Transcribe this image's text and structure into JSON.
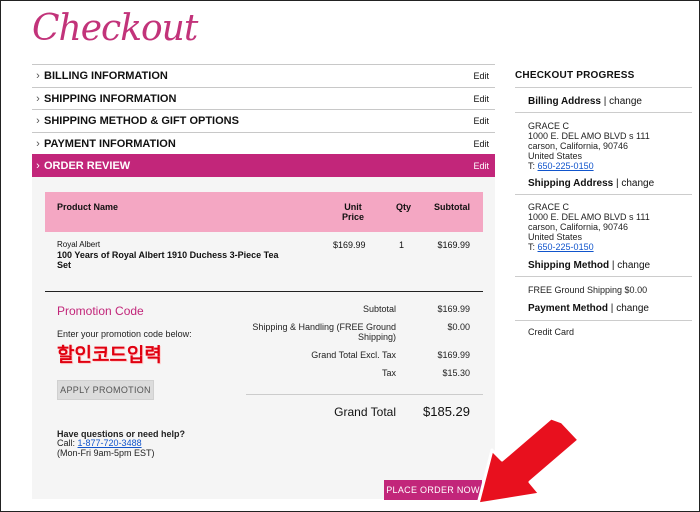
{
  "logo": "Checkout",
  "accordion": [
    {
      "label": "BILLING INFORMATION",
      "edit": "Edit"
    },
    {
      "label": "SHIPPING INFORMATION",
      "edit": "Edit"
    },
    {
      "label": "SHIPPING METHOD & GIFT OPTIONS",
      "edit": "Edit"
    },
    {
      "label": "PAYMENT INFORMATION",
      "edit": "Edit"
    },
    {
      "label": "ORDER REVIEW",
      "edit": "Edit"
    }
  ],
  "table": {
    "col_product": "Product Name",
    "col_unit_price_1": "Unit",
    "col_unit_price_2": "Price",
    "col_qty": "Qty",
    "col_subtotal": "Subtotal"
  },
  "item": {
    "brand": "Royal Albert",
    "name_line1": "100 Years of Royal Albert 1910 Duchess 3-Piece Tea",
    "name_line2": "Set",
    "unit_price": "$169.99",
    "qty": "1",
    "subtotal": "$169.99"
  },
  "promo": {
    "title": "Promotion Code",
    "subtitle": "Enter your promotion code below:",
    "input_value": "할인코드입력",
    "apply_label": "APPLY PROMOTION"
  },
  "totals": {
    "subtotal_label": "Subtotal",
    "subtotal": "$169.99",
    "shipping_label_1": "Shipping & Handling (FREE Ground",
    "shipping_label_2": "Shipping)",
    "shipping": "$0.00",
    "gt_excl_label": "Grand Total Excl. Tax",
    "gt_excl": "$169.99",
    "tax_label": "Tax",
    "tax": "$15.30",
    "grand_total_label": "Grand Total",
    "grand_total": "$185.29"
  },
  "help": {
    "title": "Have questions or need help?",
    "call_label": "Call:",
    "phone": "1-877-720-3488",
    "hours": "(Mon-Fri 9am-5pm EST)"
  },
  "place_order_label": "PLACE ORDER NOW",
  "progress": {
    "title": "CHECKOUT PROGRESS",
    "billing_head": "Billing Address",
    "shipping_head": "Shipping Address",
    "method_head": "Shipping Method",
    "payment_head": "Payment Method",
    "sep": "|",
    "change": "change",
    "billing": {
      "name": "GRACE C",
      "street": "1000 E. DEL AMO BLVD s 111",
      "city": "carson, California, 90746",
      "country": "United States",
      "phone_prefix": "T:",
      "phone": "650-225-0150"
    },
    "shipping": {
      "name": "GRACE C",
      "street": "1000 E. DEL AMO BLVD s 111",
      "city": "carson, California, 90746",
      "country": "United States",
      "phone_prefix": "T:",
      "phone": "650-225-0150"
    },
    "method": "FREE Ground Shipping $0.00",
    "payment": "Credit Card"
  },
  "colors": {
    "accent": "#c2267a",
    "table_header": "#f4a7c3",
    "arrow": "#e8101e"
  }
}
